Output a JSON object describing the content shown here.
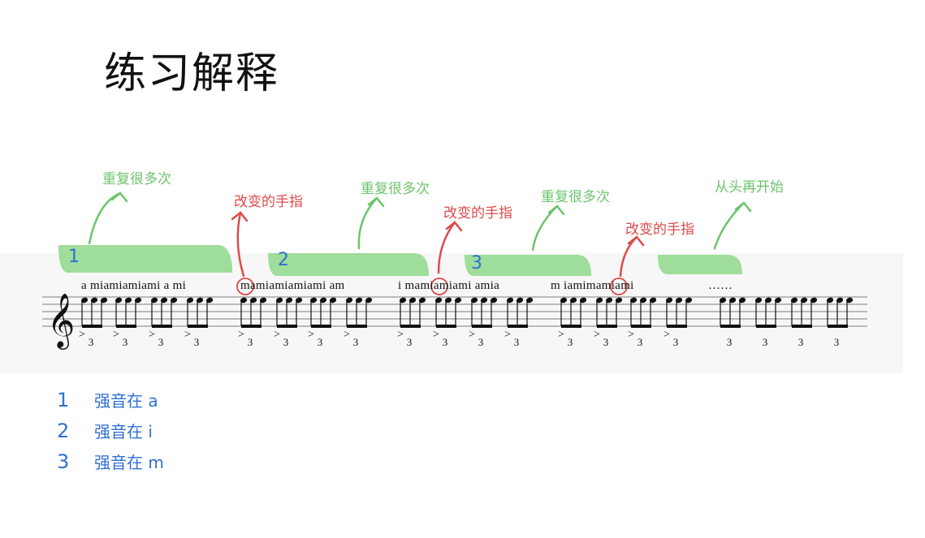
{
  "title": "练习解释",
  "annotations": {
    "repeat": "重复很多次",
    "change": "改变的手指",
    "restart": "从头再开始"
  },
  "finger_groups": [
    "a miamiamiami a mi",
    "mamiamiamiami am",
    "i mamiamiami amia",
    "m iamimamiami",
    "……"
  ],
  "group_numbers": [
    "1",
    "2",
    "3"
  ],
  "triplet_label": "3",
  "accent_mark": ">",
  "legend": [
    {
      "num": "1",
      "label": "强音在  a"
    },
    {
      "num": "2",
      "label": "强音在  i"
    },
    {
      "num": "3",
      "label": "强音在  m"
    }
  ],
  "colors": {
    "highlight": "#8ed88a",
    "repeat_text": "#6cc46c",
    "change_text": "#de4a4a",
    "legend_text": "#2f6fd6",
    "notation": "#111111"
  }
}
